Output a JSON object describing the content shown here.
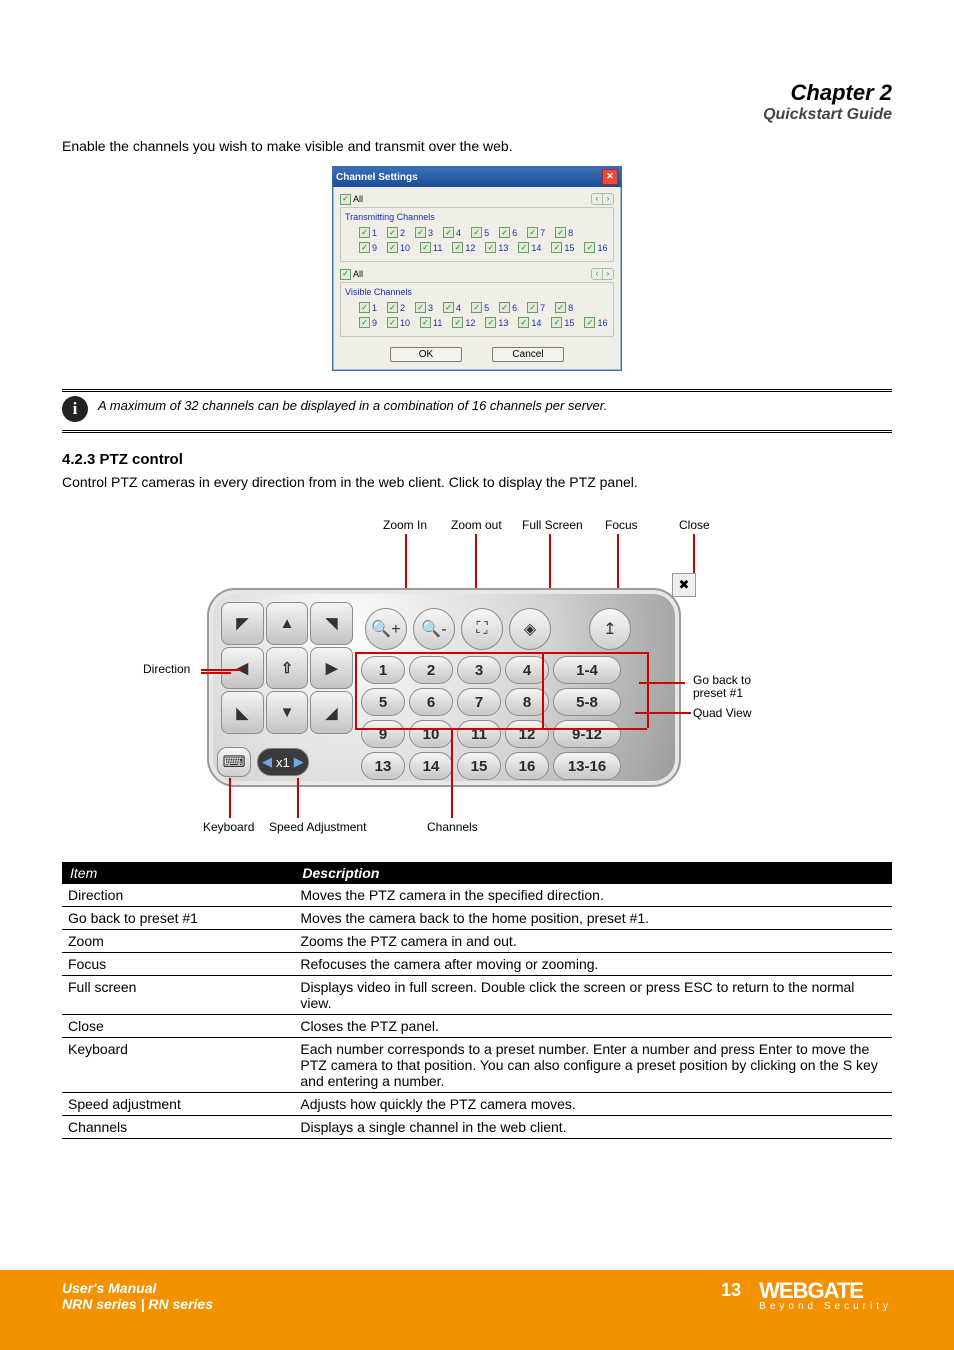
{
  "page_header": {
    "chapter": "Chapter 2",
    "title": "Quickstart Guide"
  },
  "dialog_section": {
    "below_text": "Enable the channels you wish to make visible and transmit over the web.",
    "title": "Channel Settings",
    "all_label": "All",
    "group1": "Transmitting Channels",
    "group2": "Visible Channels",
    "channels_upper": [
      "1",
      "2",
      "3",
      "4",
      "5",
      "6",
      "7",
      "8"
    ],
    "channels_lower": [
      "9",
      "10",
      "11",
      "12",
      "13",
      "14",
      "15",
      "16"
    ],
    "ok": "OK",
    "cancel": "Cancel"
  },
  "note": "A maximum of 32 channels can be displayed in a combination of 16 channels per server.",
  "ptz": {
    "heading": "4.2.3 PTZ control",
    "intro": "Control PTZ cameras in every direction from in the web client. Click  to display the PTZ panel.",
    "labels": {
      "zoom_in": "Zoom In",
      "zoom_out": "Zoom out",
      "full_screen": "Full Screen",
      "focus": "Focus",
      "close": "Close",
      "direction": "Direction",
      "go_back": "Go back to\npreset #1",
      "keyboard": "Keyboard",
      "speed": "Speed Adjustment",
      "channels": "Channels",
      "quad": "Quad View"
    },
    "buttons": {
      "channels": [
        "1",
        "2",
        "3",
        "4",
        "5",
        "6",
        "7",
        "8",
        "9",
        "10",
        "11",
        "12",
        "13",
        "14",
        "15",
        "16"
      ],
      "quad": [
        "1-4",
        "5-8",
        "9-12",
        "13-16"
      ],
      "speed": "x1"
    },
    "icon_names": {
      "zoom_in": "zoom-in-icon",
      "zoom_out": "zoom-out-icon",
      "full_screen": "full-screen-icon",
      "focus": "focus-icon",
      "home": "home-preset-icon",
      "close": "close-icon",
      "keyboard": "keyboard-icon"
    }
  },
  "table": {
    "header_item": "Item",
    "header_desc": "Description",
    "rows": [
      {
        "item": "Direction",
        "desc": "Moves the PTZ camera in the specified direction."
      },
      {
        "item": "Go back to preset #1",
        "desc": "Moves the camera back to the home position, preset #1."
      },
      {
        "item": "Zoom",
        "desc": "Zooms the PTZ camera in and out."
      },
      {
        "item": "Focus",
        "desc": "Refocuses the camera after moving or zooming."
      },
      {
        "item": "Full screen",
        "desc": "Displays video in full screen. Double click the screen or press ESC to return to the normal view."
      },
      {
        "item": "Close",
        "desc": "Closes the PTZ panel."
      },
      {
        "item": "Keyboard",
        "desc": "Each number corresponds to a preset number. Enter a number and press Enter to move the PTZ camera to that position. You can also configure a preset position by clicking on the S key and entering a number."
      },
      {
        "item": "Speed adjustment",
        "desc": "Adjusts how quickly the PTZ camera moves."
      },
      {
        "item": "Channels",
        "desc": "Displays a single channel in the web client."
      }
    ]
  },
  "footer": {
    "left_line1": "User's Manual",
    "left_line2": "NRN series | RN series",
    "page": "13",
    "brand": "WEBGATE",
    "tag": "Beyond Security"
  }
}
